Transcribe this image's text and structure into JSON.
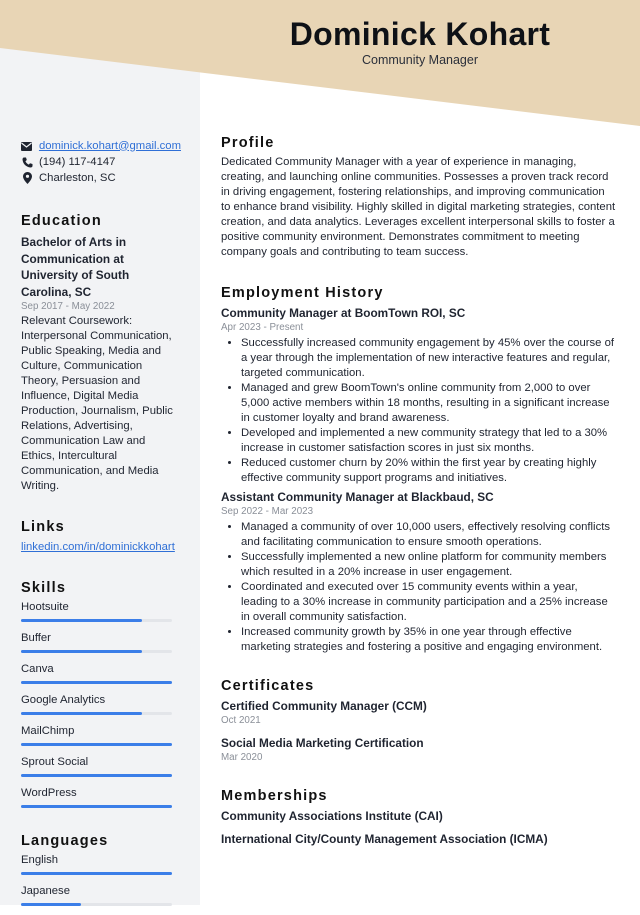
{
  "header": {
    "name": "Dominick Kohart",
    "title": "Community Manager",
    "band_color": "#e8d5b5"
  },
  "contact": {
    "email": "dominick.kohart@gmail.com",
    "phone": "(194) 117-4147",
    "location": "Charleston, SC"
  },
  "education": {
    "heading": "Education",
    "degree": "Bachelor of Arts in Communication at University of South Carolina, SC",
    "dates": "Sep 2017 - May 2022",
    "coursework": "Relevant Coursework: Interpersonal Communication, Public Speaking, Media and Culture, Communication Theory, Persuasion and Influence, Digital Media Production, Journalism, Public Relations, Advertising, Communication Law and Ethics, Intercultural Communication, and Media Writing."
  },
  "links": {
    "heading": "Links",
    "items": [
      {
        "label": "linkedin.com/in/dominickkohart"
      }
    ]
  },
  "skills": {
    "heading": "Skills",
    "items": [
      {
        "name": "Hootsuite",
        "level": 0.8
      },
      {
        "name": "Buffer",
        "level": 0.8
      },
      {
        "name": "Canva",
        "level": 1.0
      },
      {
        "name": "Google Analytics",
        "level": 0.8
      },
      {
        "name": "MailChimp",
        "level": 1.0
      },
      {
        "name": "Sprout Social",
        "level": 1.0
      },
      {
        "name": "WordPress",
        "level": 1.0
      }
    ]
  },
  "languages": {
    "heading": "Languages",
    "items": [
      {
        "name": "English",
        "level": 1.0
      },
      {
        "name": "Japanese",
        "level": 0.4
      }
    ]
  },
  "profile": {
    "heading": "Profile",
    "text": "Dedicated Community Manager with a year of experience in managing, creating, and launching online communities. Possesses a proven track record in driving engagement, fostering relationships, and improving communication to enhance brand visibility. Highly skilled in digital marketing strategies, content creation, and data analytics. Leverages excellent interpersonal skills to foster a positive community environment. Demonstrates commitment to meeting company goals and contributing to team success."
  },
  "employment": {
    "heading": "Employment History",
    "jobs": [
      {
        "title": "Community Manager at BoomTown ROI, SC",
        "dates": "Apr 2023 - Present",
        "bullets": [
          "Successfully increased community engagement by 45% over the course of a year through the implementation of new interactive features and regular, targeted communication.",
          "Managed and grew BoomTown's online community from 2,000 to over 5,000 active members within 18 months, resulting in a significant increase in customer loyalty and brand awareness.",
          "Developed and implemented a new community strategy that led to a 30% increase in customer satisfaction scores in just six months.",
          "Reduced customer churn by 20% within the first year by creating highly effective community support programs and initiatives."
        ]
      },
      {
        "title": "Assistant Community Manager at Blackbaud, SC",
        "dates": "Sep 2022 - Mar 2023",
        "bullets": [
          "Managed a community of over 10,000 users, effectively resolving conflicts and facilitating communication to ensure smooth operations.",
          "Successfully implemented a new online platform for community members which resulted in a 20% increase in user engagement.",
          "Coordinated and executed over 15 community events within a year, leading to a 30% increase in community participation and a 25% increase in overall community satisfaction.",
          "Increased community growth by 35% in one year through effective marketing strategies and fostering a positive and engaging environment."
        ]
      }
    ]
  },
  "certificates": {
    "heading": "Certificates",
    "items": [
      {
        "name": "Certified Community Manager (CCM)",
        "date": "Oct 2021"
      },
      {
        "name": "Social Media Marketing Certification",
        "date": "Mar 2020"
      }
    ]
  },
  "memberships": {
    "heading": "Memberships",
    "items": [
      "Community Associations Institute (CAI)",
      "International City/County Management Association (ICMA)"
    ]
  },
  "colors": {
    "accent": "#3b7ee8",
    "link": "#2f6fd6",
    "sidebar_bg": "#f2f3f5"
  }
}
